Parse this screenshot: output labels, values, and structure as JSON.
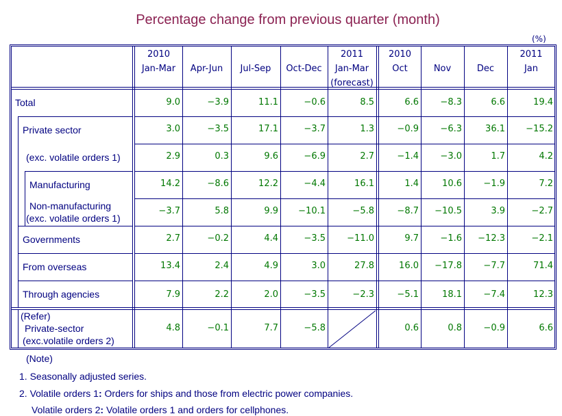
{
  "title": "Percentage change from previous quarter (month)",
  "unit": "(%)",
  "columns": [
    {
      "line1": "2010",
      "line2": "Jan-Mar",
      "line3": ""
    },
    {
      "line1": "",
      "line2": "Apr-Jun",
      "line3": ""
    },
    {
      "line1": "",
      "line2": "Jul-Sep",
      "line3": ""
    },
    {
      "line1": "",
      "line2": "Oct-Dec",
      "line3": ""
    },
    {
      "line1": "2011",
      "line2": "Jan-Mar",
      "line3": "(forecast)"
    },
    {
      "line1": "2010",
      "line2": "Oct",
      "line3": ""
    },
    {
      "line1": "",
      "line2": "Nov",
      "line3": ""
    },
    {
      "line1": "",
      "line2": "Dec",
      "line3": ""
    },
    {
      "line1": "2011",
      "line2": "Jan",
      "line3": ""
    }
  ],
  "rows": [
    {
      "label": "Total",
      "values": [
        "9.0",
        "−3.9",
        "11.1",
        "−0.6",
        "8.5",
        "6.6",
        "−8.3",
        "6.6",
        "19.4"
      ]
    },
    {
      "label": "Private sector",
      "values": [
        "3.0",
        "−3.5",
        "17.1",
        "−3.7",
        "1.3",
        "−0.9",
        "−6.3",
        "36.1",
        "−15.2"
      ]
    },
    {
      "label": "(exc. volatile orders 1)",
      "values": [
        "2.9",
        "0.3",
        "9.6",
        "−6.9",
        "2.7",
        "−1.4",
        "−3.0",
        "1.7",
        "4.2"
      ]
    },
    {
      "label": "Manufacturing",
      "values": [
        "14.2",
        "−8.6",
        "12.2",
        "−4.4",
        "16.1",
        "1.4",
        "10.6",
        "−1.9",
        "7.2"
      ]
    },
    {
      "label": "Non-manufacturing",
      "label2": "(exc. volatile orders 1)",
      "values": [
        "−3.7",
        "5.8",
        "9.9",
        "−10.1",
        "−5.8",
        "−8.7",
        "−10.5",
        "3.9",
        "−2.7"
      ]
    },
    {
      "label": "Governments",
      "values": [
        "2.7",
        "−0.2",
        "4.4",
        "−3.5",
        "−11.0",
        "9.7",
        "−1.6",
        "−12.3",
        "−2.1"
      ]
    },
    {
      "label": "From overseas",
      "values": [
        "13.4",
        "2.4",
        "4.9",
        "3.0",
        "27.8",
        "16.0",
        "−17.8",
        "−7.7",
        "71.4"
      ]
    },
    {
      "label": "Through agencies",
      "values": [
        "7.9",
        "2.2",
        "2.0",
        "−3.5",
        "−2.3",
        "−5.1",
        "18.1",
        "−7.4",
        "12.3"
      ]
    },
    {
      "label": "(Refer)",
      "label2": "Private-sector",
      "label3": "(exc.volatile orders 2)",
      "values": [
        "4.8",
        "−0.1",
        "7.7",
        "−5.8",
        "",
        "0.6",
        "0.8",
        "−0.9",
        "6.6"
      ]
    }
  ],
  "notes": {
    "heading": "(Note)",
    "n1": "1. Seasonally adjusted series.",
    "n2_prefix": "2. Volatile orders 1",
    "n2_sep": ":",
    "n2_text": " Orders for ships and those from electric power companies.",
    "n3_prefix": "Volatile orders 2",
    "n3_sep": ":",
    "n3_text": " Volatile orders 1 and orders for cellphones."
  }
}
